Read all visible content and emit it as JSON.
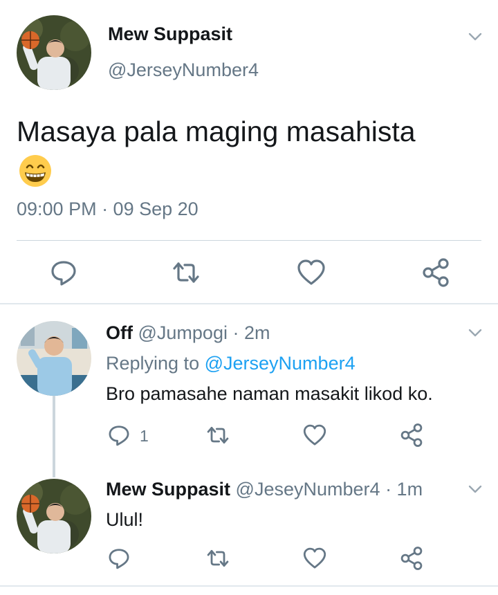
{
  "main_tweet": {
    "author_name": "Mew Suppasit",
    "author_handle": "@JerseyNumber4",
    "text": "Masaya pala maging masahista",
    "emoji": "grinning-face-emoji",
    "timestamp": "09:00 PM · 09 Sep 20",
    "actions": [
      "reply-icon",
      "retweet-icon",
      "like-icon",
      "share-icon"
    ]
  },
  "replies": [
    {
      "name": "Off",
      "handle": "@Jumpogi",
      "time": "· 2m",
      "replying_prefix": "Replying to",
      "replying_to": "@JerseyNumber4",
      "text": "Bro pamasahe naman masakit likod ko.",
      "reply_count": "1"
    },
    {
      "name": "Mew Suppasit",
      "handle": "@JeseyNumber4",
      "time": "· 1m",
      "text": "Ulul!"
    }
  ],
  "colors": {
    "text": "#14171a",
    "secondary": "#657786",
    "link": "#1da1f2",
    "icon": "#657786",
    "divider": "#ccd6dd"
  }
}
